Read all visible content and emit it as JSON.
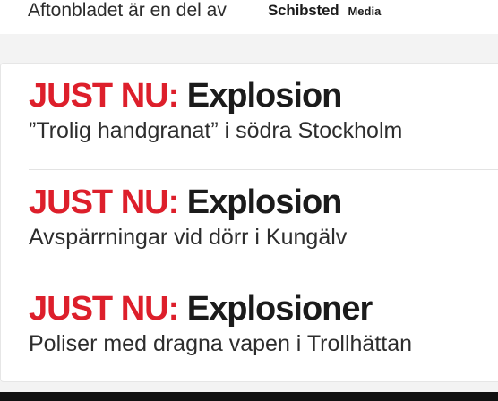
{
  "header": {
    "prefix_text": "Aftonbladet är en del av",
    "logo_main": "Schibsted",
    "logo_sub": "Media"
  },
  "stories": [
    {
      "kicker": "JUST NU:",
      "title": "Explosion",
      "subtitle": "”Trolig handgranat” i södra Stockholm"
    },
    {
      "kicker": "JUST NU:",
      "title": "Explosion",
      "subtitle": "Avspärrningar vid dörr i Kungälv"
    },
    {
      "kicker": "JUST NU:",
      "title": "Explosioner",
      "subtitle": "Poliser med dragna vapen i Trollhättan"
    }
  ],
  "colors": {
    "kicker": "#dd1f2b",
    "headline": "#1b1b1b",
    "background": "#f3f3f3"
  }
}
